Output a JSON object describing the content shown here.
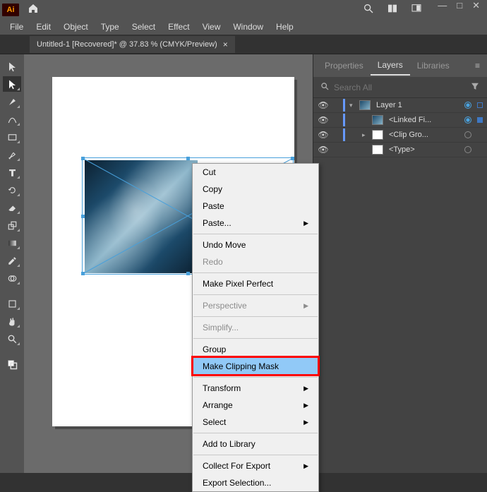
{
  "titlebar": {
    "badge": "Ai"
  },
  "menubar": [
    "File",
    "Edit",
    "Object",
    "Type",
    "Select",
    "Effect",
    "View",
    "Window",
    "Help"
  ],
  "document": {
    "tab_title": "Untitled-1 [Recovered]* @ 37.83 % (CMYK/Preview)"
  },
  "panel": {
    "tabs": [
      "Properties",
      "Layers",
      "Libraries"
    ],
    "active_tab": 1,
    "search_placeholder": "Search All",
    "rows": [
      {
        "indent": 0,
        "name": "Layer 1",
        "twirl": "down",
        "thumb": "image",
        "target": "sel",
        "selsq": "outline"
      },
      {
        "indent": 1,
        "name": "<Linked Fi...",
        "twirl": "",
        "thumb": "image",
        "target": "sel",
        "selsq": "on"
      },
      {
        "indent": 1,
        "name": "<Clip Gro...",
        "twirl": "right",
        "thumb": "white",
        "target": "plain",
        "selsq": ""
      },
      {
        "indent": 1,
        "name": "<Type>",
        "twirl": "",
        "thumb": "white",
        "target": "plain",
        "selsq": ""
      }
    ]
  },
  "context_menu": {
    "items": [
      {
        "label": "Cut"
      },
      {
        "label": "Copy"
      },
      {
        "label": "Paste"
      },
      {
        "label": "Paste...",
        "submenu": true
      },
      {
        "sep": true
      },
      {
        "label": "Undo Move"
      },
      {
        "label": "Redo",
        "disabled": true
      },
      {
        "sep": true
      },
      {
        "label": "Make Pixel Perfect"
      },
      {
        "sep": true
      },
      {
        "label": "Perspective",
        "submenu": true,
        "disabled": true
      },
      {
        "sep": true
      },
      {
        "label": "Simplify...",
        "disabled": true
      },
      {
        "sep": true
      },
      {
        "label": "Group"
      },
      {
        "label": "Make Clipping Mask",
        "highlighted": true
      },
      {
        "sep": true
      },
      {
        "label": "Transform",
        "submenu": true
      },
      {
        "label": "Arrange",
        "submenu": true
      },
      {
        "label": "Select",
        "submenu": true
      },
      {
        "sep": true
      },
      {
        "label": "Add to Library"
      },
      {
        "sep": true
      },
      {
        "label": "Collect For Export",
        "submenu": true
      },
      {
        "label": "Export Selection..."
      }
    ]
  },
  "tools": [
    "selection",
    "direct-selection",
    "pen",
    "curvature",
    "type",
    "line",
    "rectangle",
    "brush",
    "shaper",
    "eraser",
    "rotate",
    "scale",
    "width",
    "free-transform",
    "shape-builder",
    "live-paint",
    "gradient",
    "eyedropper",
    "blend",
    "symbol-sprayer",
    "column-graph",
    "artboard",
    "slice",
    "hand",
    "zoom",
    "swap-fill",
    "fill-stroke"
  ]
}
